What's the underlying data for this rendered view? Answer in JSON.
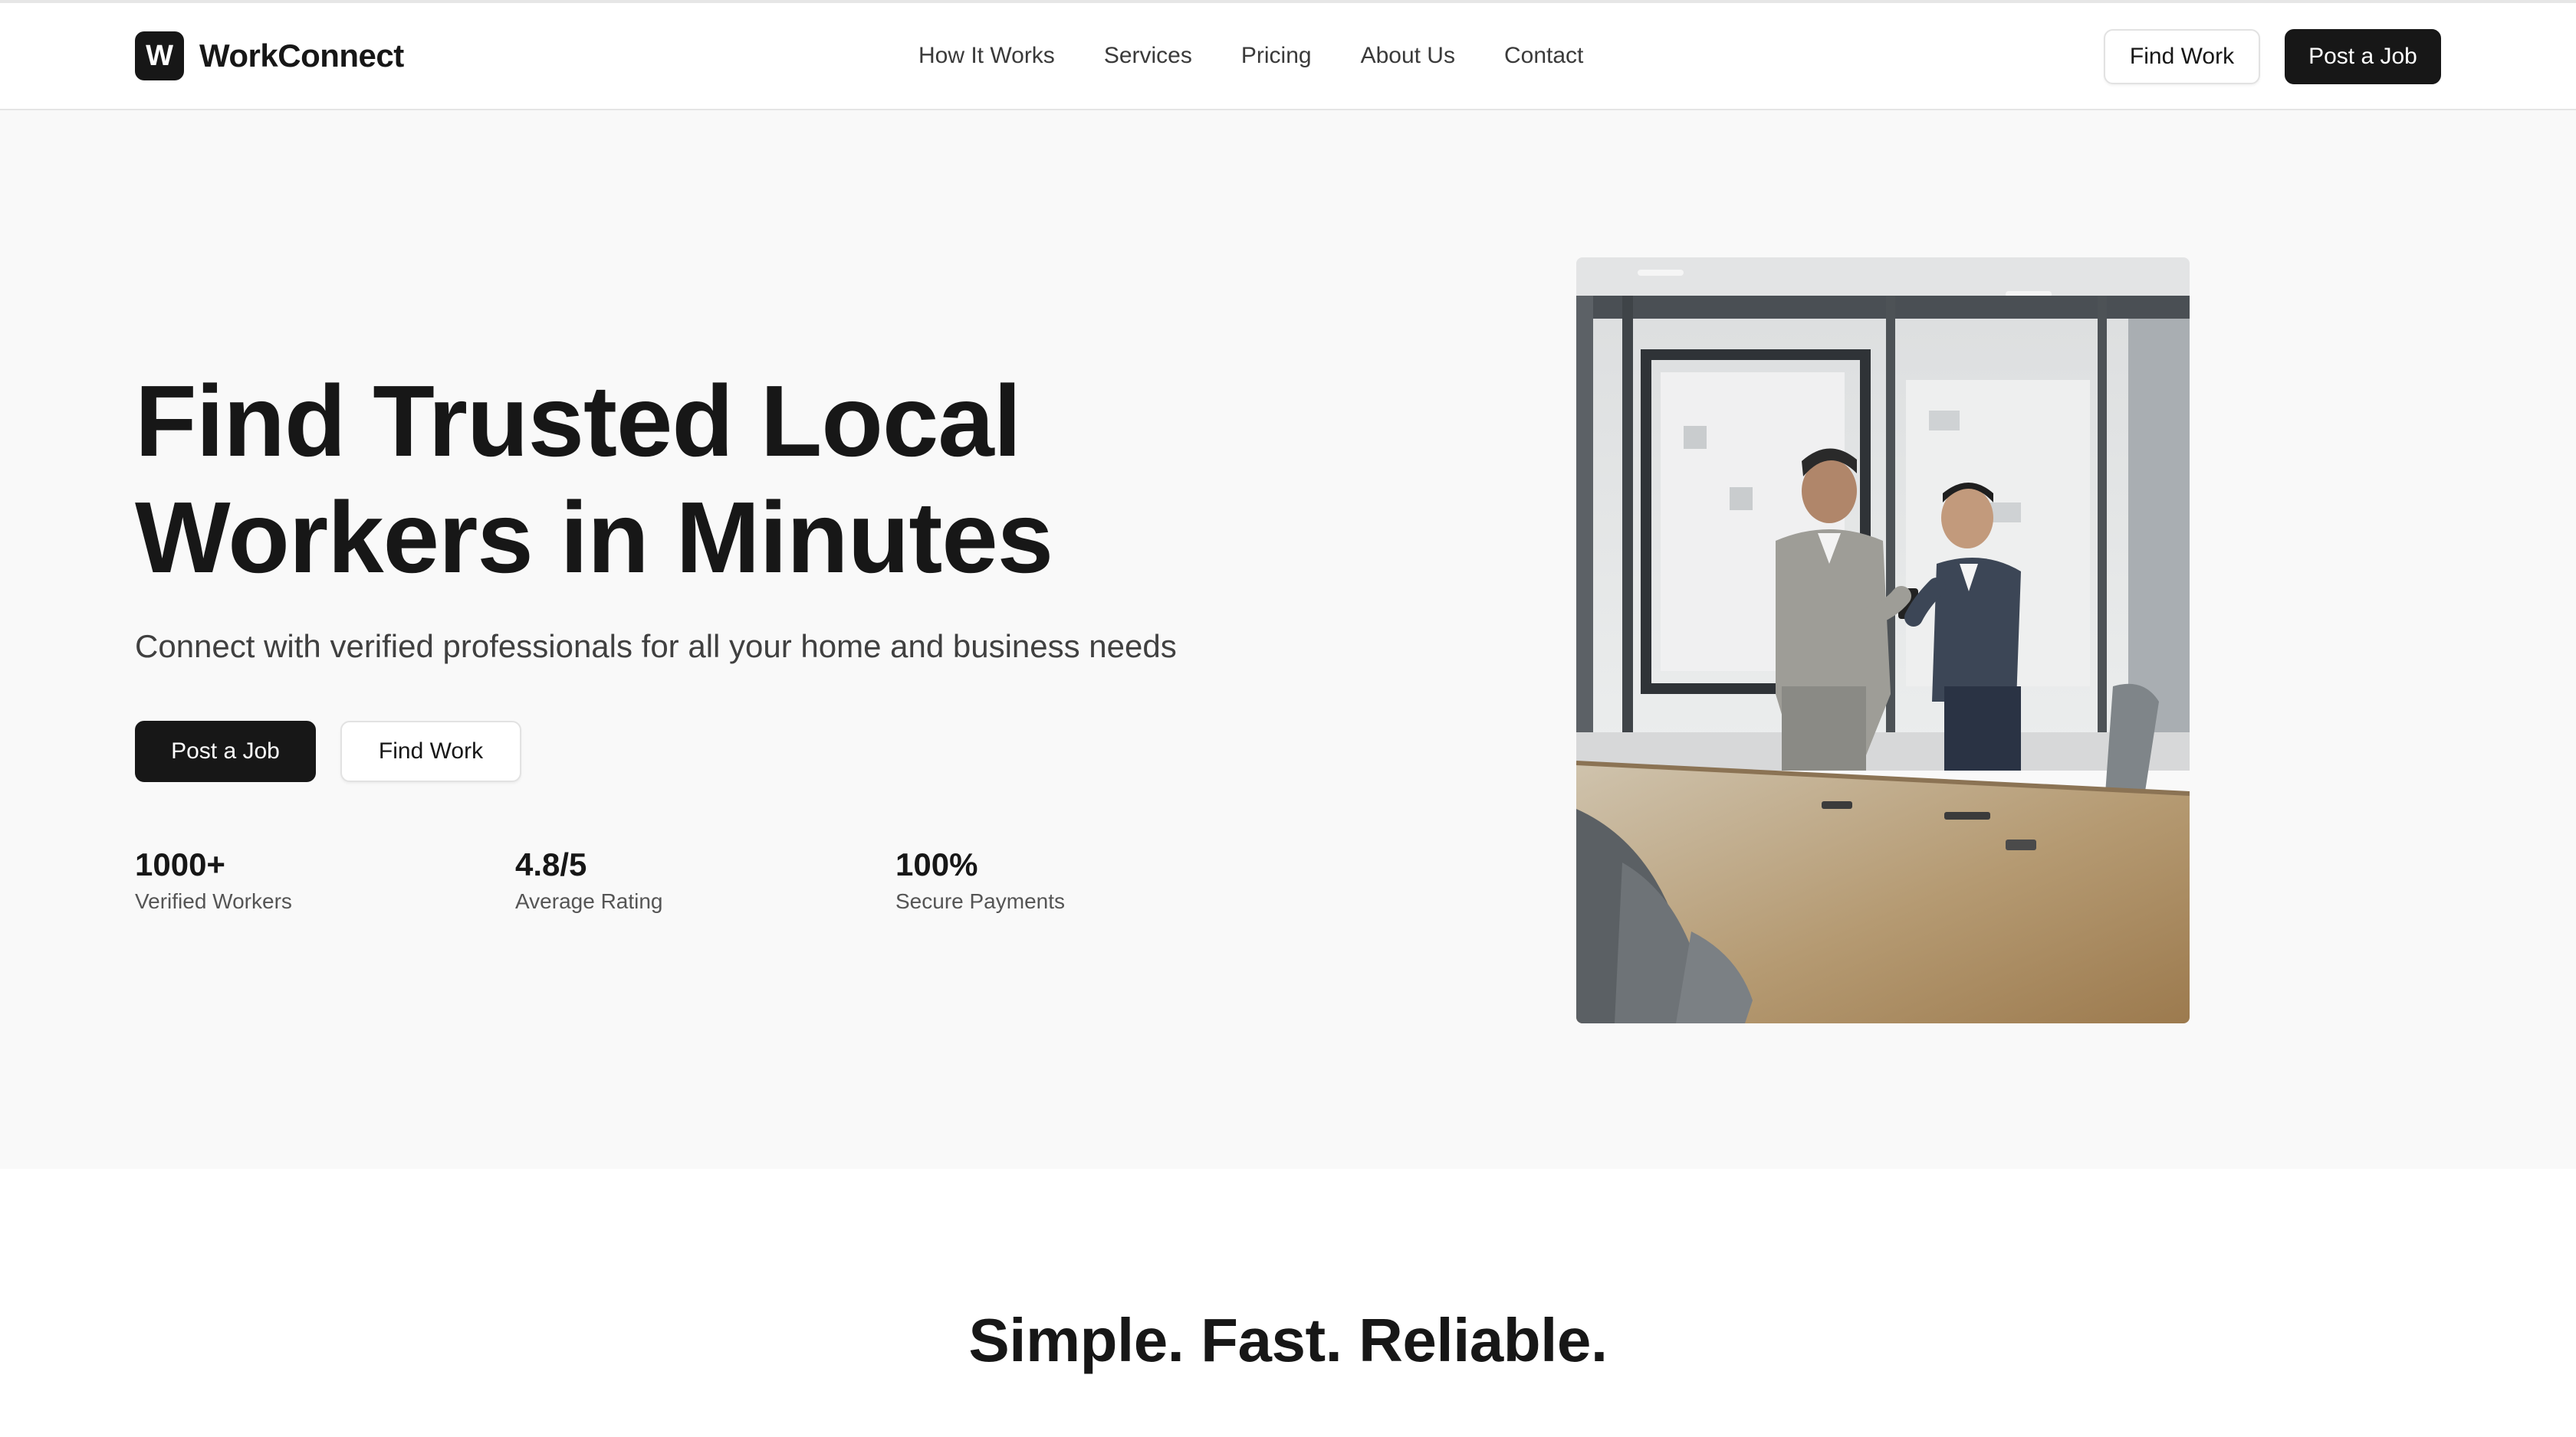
{
  "brand": {
    "logo_letter": "W",
    "name": "WorkConnect"
  },
  "nav": {
    "links": [
      "How It Works",
      "Services",
      "Pricing",
      "About Us",
      "Contact"
    ],
    "find_work_label": "Find Work",
    "post_job_label": "Post a Job"
  },
  "hero": {
    "title_line1": "Find Trusted Local",
    "title_line2": "Workers in Minutes",
    "subtitle": "Connect with verified professionals for all your home and business needs",
    "post_job_label": "Post a Job",
    "find_work_label": "Find Work",
    "stats": [
      {
        "value": "1000+",
        "label": "Verified Workers"
      },
      {
        "value": "4.8/5",
        "label": "Average Rating"
      },
      {
        "value": "100%",
        "label": "Secure Payments"
      }
    ]
  },
  "section": {
    "title": "Simple. Fast. Reliable."
  },
  "colors": {
    "primary": "#171717",
    "hero_bg": "#f9f9f9",
    "border": "#e5e5e5",
    "text_muted": "#555555"
  }
}
